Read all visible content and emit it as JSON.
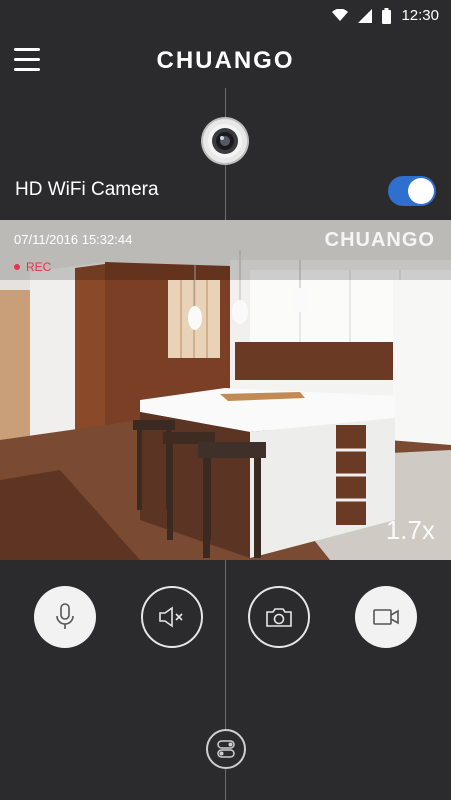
{
  "status_bar": {
    "time": "12:30",
    "icons": [
      "wifi-icon",
      "cell-signal-icon",
      "battery-icon"
    ]
  },
  "header": {
    "brand": "CHUANGO",
    "menu_icon": "hamburger-menu-icon"
  },
  "camera": {
    "name": "HD WiFi Camera",
    "enabled": true,
    "toggle_color": "#2f6fd0"
  },
  "feed": {
    "timestamp": "07/11/2016  15:32:44",
    "rec_label": "REC",
    "rec_color": "#e8334d",
    "watermark": "CHUANGO",
    "zoom": "1.7x"
  },
  "controls": [
    {
      "name": "microphone-button",
      "icon": "microphone-icon",
      "style": "filled"
    },
    {
      "name": "mute-button",
      "icon": "speaker-muted-icon",
      "style": "outline"
    },
    {
      "name": "snapshot-button",
      "icon": "camera-icon",
      "style": "outline"
    },
    {
      "name": "record-video-button",
      "icon": "video-camera-icon",
      "style": "filled"
    }
  ],
  "bottom_control": {
    "icon": "toggle-switches-icon"
  }
}
